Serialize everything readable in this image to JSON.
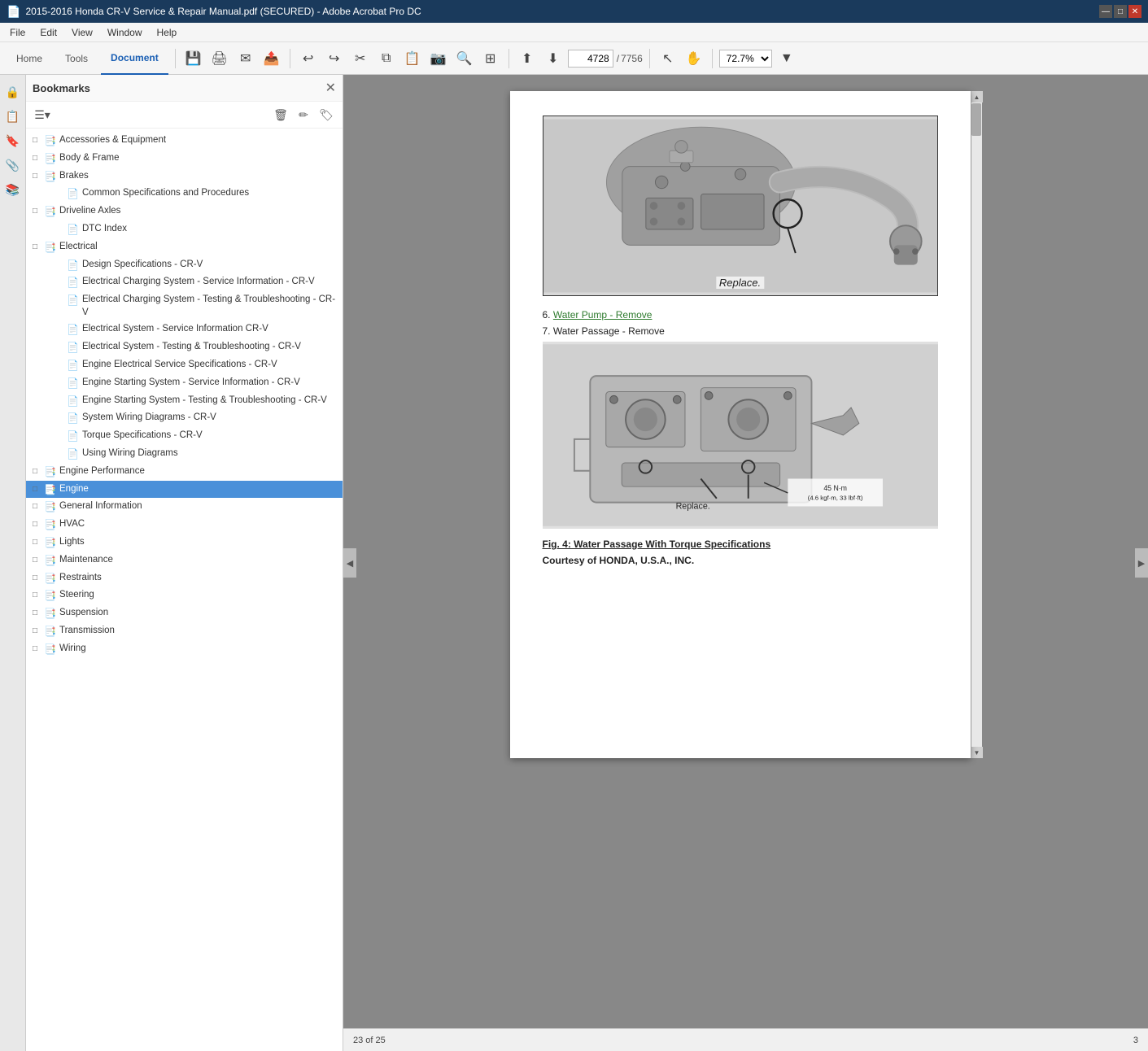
{
  "titleBar": {
    "icon": "📄",
    "text": "2015-2016 Honda CR-V Service & Repair Manual.pdf (SECURED) - Adobe Acrobat Pro DC",
    "controls": [
      "—",
      "□",
      "✕"
    ]
  },
  "menuBar": {
    "items": [
      "File",
      "Edit",
      "View",
      "Window",
      "Help"
    ]
  },
  "toolbar": {
    "tabs": [
      "Home",
      "Tools",
      "Document"
    ],
    "activeTab": "Document",
    "pageNumber": "4728",
    "totalPages": "7756",
    "zoom": "72.7%"
  },
  "bookmarks": {
    "title": "Bookmarks",
    "items": [
      {
        "level": 0,
        "toggle": "□",
        "icon": "📑",
        "label": "Accessories & Equipment",
        "expanded": false
      },
      {
        "level": 0,
        "toggle": "□",
        "icon": "📑",
        "label": "Body & Frame",
        "expanded": false
      },
      {
        "level": 0,
        "toggle": "□",
        "icon": "📑",
        "label": "Brakes",
        "expanded": true
      },
      {
        "level": 1,
        "toggle": "",
        "icon": "📄",
        "label": "Common Specifications and Procedures",
        "expanded": false
      },
      {
        "level": 0,
        "toggle": "□",
        "icon": "📑",
        "label": "Driveline Axles",
        "expanded": false
      },
      {
        "level": 1,
        "toggle": "",
        "icon": "📄",
        "label": "DTC Index",
        "expanded": false
      },
      {
        "level": 0,
        "toggle": "□",
        "icon": "📑",
        "label": "Electrical",
        "expanded": true
      },
      {
        "level": 1,
        "toggle": "",
        "icon": "📄",
        "label": "Design Specifications - CR-V",
        "expanded": false
      },
      {
        "level": 1,
        "toggle": "",
        "icon": "📄",
        "label": "Electrical Charging System - Service Information - CR-V",
        "expanded": false
      },
      {
        "level": 1,
        "toggle": "",
        "icon": "📄",
        "label": "Electrical Charging System - Testing & Troubleshooting - CR-V",
        "expanded": false
      },
      {
        "level": 1,
        "toggle": "",
        "icon": "📄",
        "label": "Electrical System - Service Information CR-V",
        "expanded": false
      },
      {
        "level": 1,
        "toggle": "",
        "icon": "📄",
        "label": "Electrical System - Testing & Troubleshooting - CR-V",
        "expanded": false
      },
      {
        "level": 1,
        "toggle": "",
        "icon": "📄",
        "label": "Engine Electrical Service Specifications - CR-V",
        "expanded": false
      },
      {
        "level": 1,
        "toggle": "",
        "icon": "📄",
        "label": "Engine Starting System - Service Information - CR-V",
        "expanded": false
      },
      {
        "level": 1,
        "toggle": "",
        "icon": "📄",
        "label": "Engine Starting System - Testing & Troubleshooting - CR-V",
        "expanded": false
      },
      {
        "level": 1,
        "toggle": "",
        "icon": "📄",
        "label": "System Wiring Diagrams - CR-V",
        "expanded": false
      },
      {
        "level": 1,
        "toggle": "",
        "icon": "📄",
        "label": "Torque Specifications - CR-V",
        "expanded": false
      },
      {
        "level": 1,
        "toggle": "",
        "icon": "📄",
        "label": "Using Wiring Diagrams",
        "expanded": false
      },
      {
        "level": 0,
        "toggle": "□",
        "icon": "📑",
        "label": "Engine Performance",
        "expanded": false
      },
      {
        "level": 0,
        "toggle": "□",
        "icon": "📑",
        "label": "Engine",
        "expanded": false,
        "active": true
      },
      {
        "level": 0,
        "toggle": "□",
        "icon": "📑",
        "label": "General Information",
        "expanded": false
      },
      {
        "level": 0,
        "toggle": "□",
        "icon": "📑",
        "label": "HVAC",
        "expanded": false
      },
      {
        "level": 0,
        "toggle": "□",
        "icon": "📑",
        "label": "Lights",
        "expanded": false
      },
      {
        "level": 0,
        "toggle": "□",
        "icon": "📑",
        "label": "Maintenance",
        "expanded": false
      },
      {
        "level": 0,
        "toggle": "□",
        "icon": "📑",
        "label": "Restraints",
        "expanded": false
      },
      {
        "level": 0,
        "toggle": "□",
        "icon": "📑",
        "label": "Steering",
        "expanded": false
      },
      {
        "level": 0,
        "toggle": "□",
        "icon": "📑",
        "label": "Suspension",
        "expanded": false
      },
      {
        "level": 0,
        "toggle": "□",
        "icon": "📑",
        "label": "Transmission",
        "expanded": false
      },
      {
        "level": 0,
        "toggle": "□",
        "icon": "📑",
        "label": "Wiring",
        "expanded": false
      }
    ]
  },
  "pdfContent": {
    "step6Link": "Water Pump - Remove",
    "step6Number": "6.",
    "step7": "7. Water Passage - Remove",
    "figureCaption": "Fig. 4: Water Passage With Torque Specifications",
    "figureCourtesy": "Courtesy of HONDA, U.S.A., INC.",
    "replaceLabel": "Replace.",
    "pageInfo": "23 of 25",
    "pageNumber": "3",
    "torqueLabel": "45 N·m",
    "torqueSubLabel": "(4.6 kgf·m, 33 lbf·ft)",
    "replaceLabel2": "Replace."
  },
  "sidebarIcons": [
    "🔒",
    "📋",
    "🔖",
    "📎",
    "📚"
  ]
}
